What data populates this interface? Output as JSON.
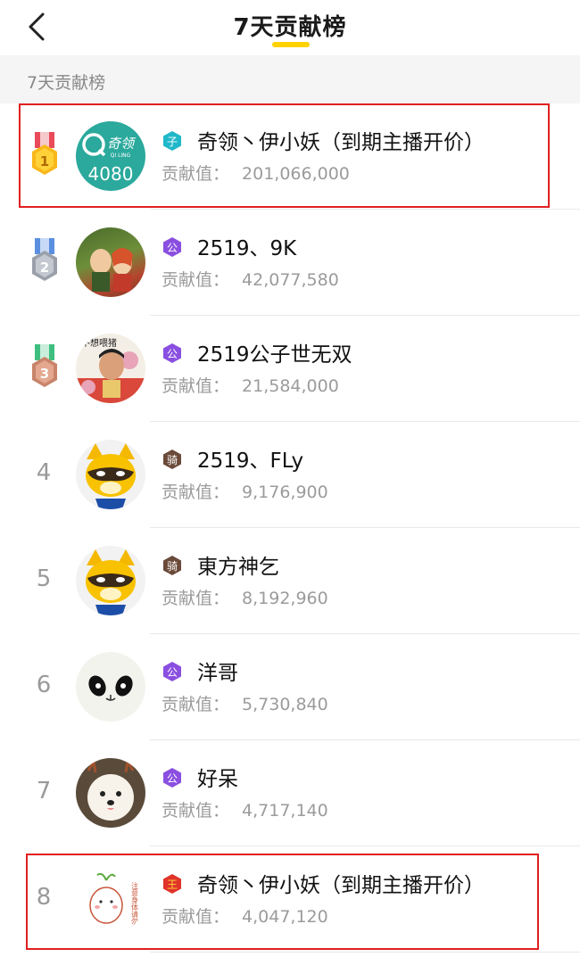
{
  "header": {
    "title": "7天贡献榜",
    "accent_color": "#ffd200"
  },
  "section": {
    "label": "7天贡献榜"
  },
  "contribution_label": "贡献值：",
  "rows": [
    {
      "rank": "1",
      "name": "奇领丶伊小妖（到期主播开价）",
      "value": "201,066,000",
      "badge_char": "子",
      "avatar_text": "4080",
      "avatar_logo": "奇领",
      "avatar_logo_sub": "QI LING"
    },
    {
      "rank": "2",
      "name": "2519、9K",
      "value": "42,077,580",
      "badge_char": "公"
    },
    {
      "rank": "3",
      "name": "2519公子世无双",
      "value": "21,584,000",
      "badge_char": "公",
      "avatar_caption": "不想喂猪"
    },
    {
      "rank": "4",
      "name": "2519、FLy",
      "value": "9,176,900",
      "badge_char": "骑"
    },
    {
      "rank": "5",
      "name": "東方神乞",
      "value": "8,192,960",
      "badge_char": "骑"
    },
    {
      "rank": "6",
      "name": "洋哥",
      "value": "5,730,840",
      "badge_char": "公"
    },
    {
      "rank": "7",
      "name": "好呆",
      "value": "4,717,140",
      "badge_char": "公"
    },
    {
      "rank": "8",
      "name": "奇领丶伊小妖（到期主播开价）",
      "value": "4,047,120",
      "badge_char": "王",
      "avatar_caption": "注意身体请勿"
    }
  ]
}
